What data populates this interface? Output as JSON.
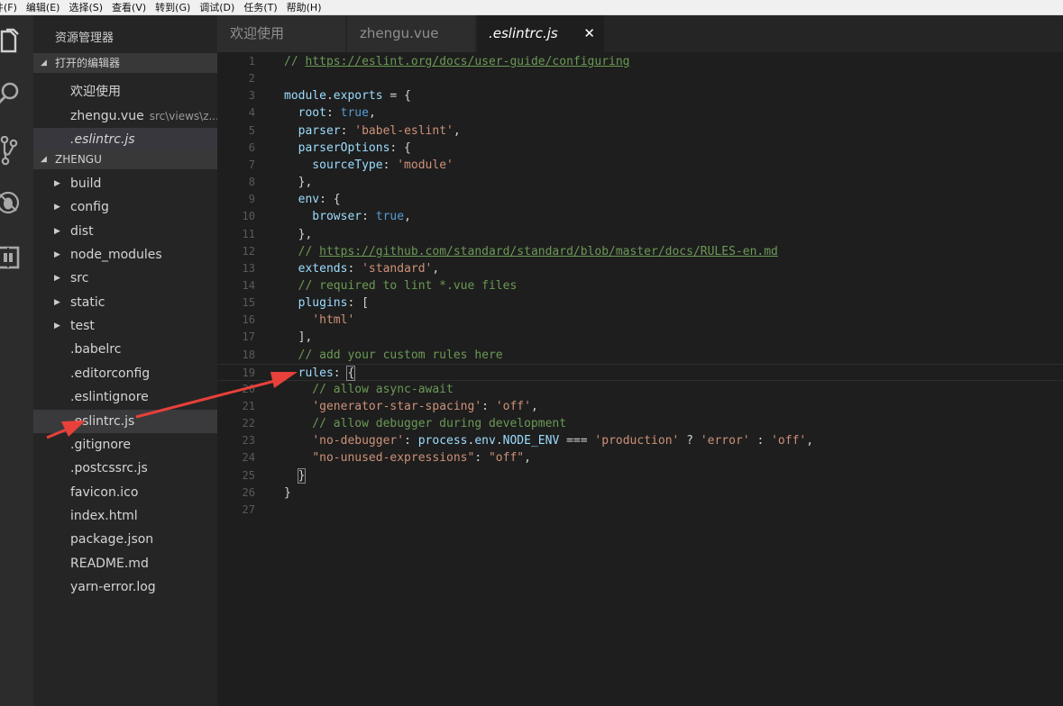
{
  "menu": [
    "件(F)",
    "编辑(E)",
    "选择(S)",
    "查看(V)",
    "转到(G)",
    "调试(D)",
    "任务(T)",
    "帮助(H)"
  ],
  "activity_bar": {
    "icons": [
      "files-icon",
      "search-icon",
      "source-control-icon",
      "debug-icon",
      "extensions-icon"
    ]
  },
  "sidebar": {
    "title": "资源管理器",
    "open_editors": {
      "label": "打开的编辑器",
      "items": [
        {
          "name": "欢迎使用",
          "path": ""
        },
        {
          "name": "zhengu.vue",
          "path": "src\\views\\z..."
        },
        {
          "name": ".eslintrc.js",
          "path": ""
        }
      ]
    },
    "project": {
      "label": "ZHENGU",
      "folders": [
        "build",
        "config",
        "dist",
        "node_modules",
        "src",
        "static",
        "test"
      ],
      "files": [
        ".babelrc",
        ".editorconfig",
        ".eslintignore",
        ".eslintrc.js",
        ".gitignore",
        ".postcssrc.js",
        "favicon.ico",
        "index.html",
        "package.json",
        "README.md",
        "yarn-error.log"
      ]
    }
  },
  "tabs": [
    {
      "label": "欢迎使用"
    },
    {
      "label": "zhengu.vue"
    },
    {
      "label": ".eslintrc.js",
      "close": "✕"
    }
  ],
  "editor": {
    "lines": [
      [
        [
          "// ",
          "comment"
        ],
        [
          "https://eslint.org/docs/user-guide/configuring",
          "link"
        ]
      ],
      [],
      [
        [
          "module",
          "prop"
        ],
        [
          ".",
          "plain"
        ],
        [
          "exports",
          "prop"
        ],
        [
          " = {",
          "plain"
        ]
      ],
      [
        [
          "  root",
          "prop"
        ],
        [
          ": ",
          "plain"
        ],
        [
          "true",
          "kw"
        ],
        [
          ",",
          "plain"
        ]
      ],
      [
        [
          "  parser",
          "prop"
        ],
        [
          ": ",
          "plain"
        ],
        [
          "'babel-eslint'",
          "str"
        ],
        [
          ",",
          "plain"
        ]
      ],
      [
        [
          "  parserOptions",
          "prop"
        ],
        [
          ": {",
          "plain"
        ]
      ],
      [
        [
          "    sourceType",
          "prop"
        ],
        [
          ": ",
          "plain"
        ],
        [
          "'module'",
          "str"
        ]
      ],
      [
        [
          "  },",
          "plain"
        ]
      ],
      [
        [
          "  env",
          "prop"
        ],
        [
          ": {",
          "plain"
        ]
      ],
      [
        [
          "    browser",
          "prop"
        ],
        [
          ": ",
          "plain"
        ],
        [
          "true",
          "kw"
        ],
        [
          ",",
          "plain"
        ]
      ],
      [
        [
          "  },",
          "plain"
        ]
      ],
      [
        [
          "  // ",
          "comment"
        ],
        [
          "https://github.com/standard/standard/blob/master/docs/RULES-en.md",
          "link"
        ]
      ],
      [
        [
          "  extends",
          "prop"
        ],
        [
          ": ",
          "plain"
        ],
        [
          "'standard'",
          "str"
        ],
        [
          ",",
          "plain"
        ]
      ],
      [
        [
          "  // required to lint *.vue files",
          "comment"
        ]
      ],
      [
        [
          "  plugins",
          "prop"
        ],
        [
          ": [",
          "plain"
        ]
      ],
      [
        [
          "    ",
          "plain"
        ],
        [
          "'html'",
          "str"
        ]
      ],
      [
        [
          "  ],",
          "plain"
        ]
      ],
      [
        [
          "  // add your custom rules here",
          "comment"
        ]
      ],
      [
        [
          "  rules",
          "prop"
        ],
        [
          ": ",
          "plain"
        ],
        [
          "{",
          "bracket"
        ]
      ],
      [
        [
          "    // allow async-await",
          "comment"
        ]
      ],
      [
        [
          "    ",
          "plain"
        ],
        [
          "'generator-star-spacing'",
          "str"
        ],
        [
          ": ",
          "plain"
        ],
        [
          "'off'",
          "str"
        ],
        [
          ",",
          "plain"
        ]
      ],
      [
        [
          "    // allow debugger during development",
          "comment"
        ]
      ],
      [
        [
          "    ",
          "plain"
        ],
        [
          "'no-debugger'",
          "str"
        ],
        [
          ": ",
          "plain"
        ],
        [
          "process",
          "prop"
        ],
        [
          ".",
          "plain"
        ],
        [
          "env",
          "prop"
        ],
        [
          ".",
          "plain"
        ],
        [
          "NODE_ENV",
          "prop"
        ],
        [
          " === ",
          "plain"
        ],
        [
          "'production'",
          "str"
        ],
        [
          " ? ",
          "plain"
        ],
        [
          "'error'",
          "str"
        ],
        [
          " : ",
          "plain"
        ],
        [
          "'off'",
          "str"
        ],
        [
          ",",
          "plain"
        ]
      ],
      [
        [
          "    ",
          "plain"
        ],
        [
          "\"no-unused-expressions\"",
          "str"
        ],
        [
          ": ",
          "plain"
        ],
        [
          "\"off\"",
          "str"
        ],
        [
          ",",
          "plain"
        ]
      ],
      [
        [
          "  ",
          "plain"
        ],
        [
          "}",
          "bracket"
        ]
      ],
      [
        [
          "}",
          "plain"
        ]
      ],
      []
    ],
    "current_line": 19
  },
  "colors": {
    "annotation_arrow": "#e8403a",
    "comment": "#6a9955",
    "string": "#ce9178",
    "keyword": "#569cd6",
    "property": "#9cdcfe"
  }
}
